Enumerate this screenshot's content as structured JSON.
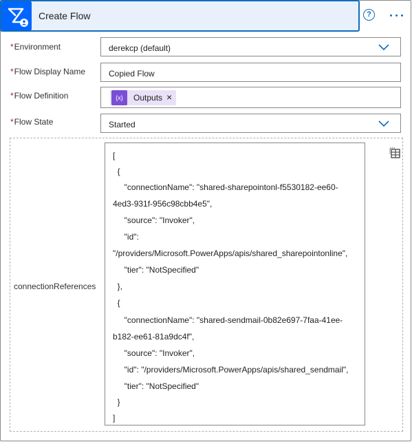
{
  "header": {
    "title": "Create Flow",
    "app_icon": "power-automate-icon",
    "help_glyph": "?",
    "more_glyph": "ellipsis"
  },
  "fields": {
    "required_mark": "*",
    "environment": {
      "label": "Environment",
      "value": "derekcp (default)"
    },
    "display_name": {
      "label": "Flow Display Name",
      "value": "Copied Flow"
    },
    "definition": {
      "label": "Flow Definition",
      "token_label": "Outputs",
      "token_icon_text": "{x}",
      "token_remove": "×"
    },
    "state": {
      "label": "Flow State",
      "value": "Started"
    }
  },
  "connection_references": {
    "label": "connectionReferences",
    "lines": [
      "[",
      "  {",
      "     \"connectionName\": \"shared-sharepointonl-f5530182-ee60-",
      "4ed3-931f-956c98cbb4e5\",",
      "     \"source\": \"Invoker\",",
      "     \"id\":",
      "\"/providers/Microsoft.PowerApps/apis/shared_sharepointonline\",",
      "     \"tier\": \"NotSpecified\"",
      "  },",
      "  {",
      "     \"connectionName\": \"shared-sendmail-0b82e697-7faa-41ee-",
      "b182-ee61-81a9dc4f\",",
      "     \"source\": \"Invoker\",",
      "     \"id\": \"/providers/Microsoft.PowerApps/apis/shared_sendmail\",",
      "     \"tier\": \"NotSpecified\"",
      "  }",
      "]"
    ]
  },
  "colors": {
    "accent": "#0f6cbd",
    "header_bg": "#e8f0fb",
    "app_icon_bg": "#0066ff",
    "token_bg": "#e9e1f7",
    "token_icon_bg": "#7a4fd6",
    "required": "#a4262c"
  }
}
